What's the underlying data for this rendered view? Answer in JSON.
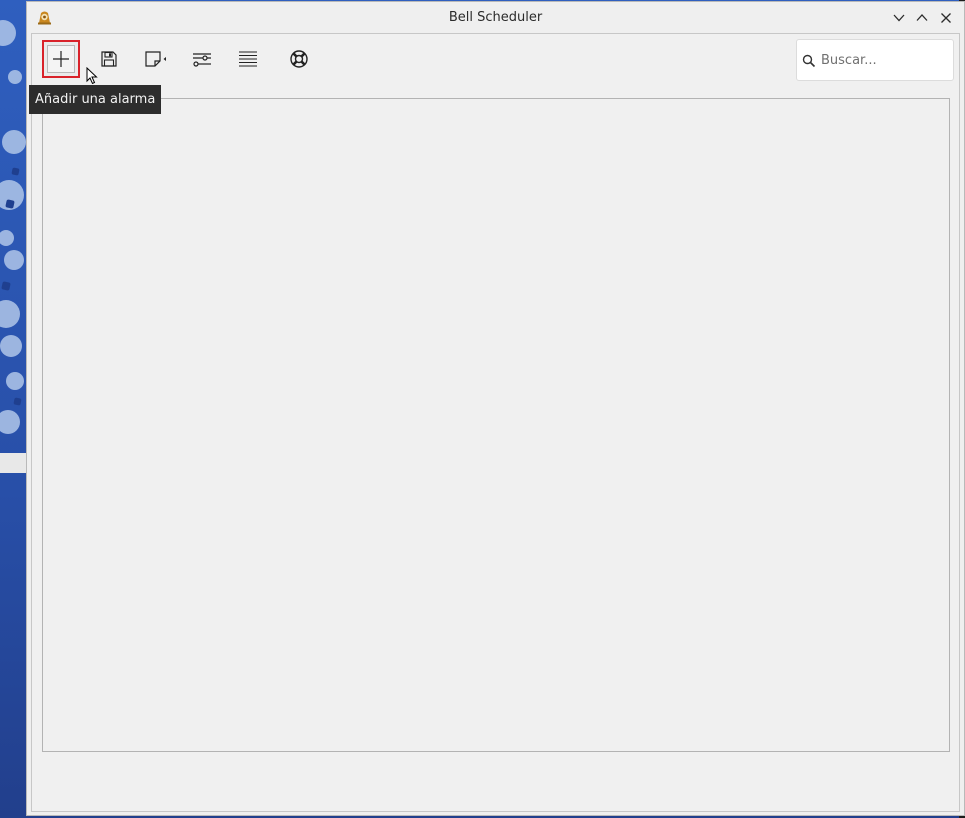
{
  "window": {
    "title": "Bell Scheduler"
  },
  "toolbar": {
    "buttons": [
      {
        "icon": "add-icon",
        "tooltip": "Añadir una alarma"
      },
      {
        "icon": "save-icon"
      },
      {
        "icon": "edit-icon"
      },
      {
        "icon": "settings-sliders-icon"
      },
      {
        "icon": "list-icon"
      },
      {
        "icon": "help-lifebuoy-icon"
      }
    ],
    "add_tooltip": "Añadir una alarma"
  },
  "search": {
    "placeholder": "Buscar...",
    "value": ""
  },
  "colors": {
    "highlight_border": "#d9222a",
    "tooltip_bg": "#2d2d2d",
    "window_bg": "#efefef"
  }
}
